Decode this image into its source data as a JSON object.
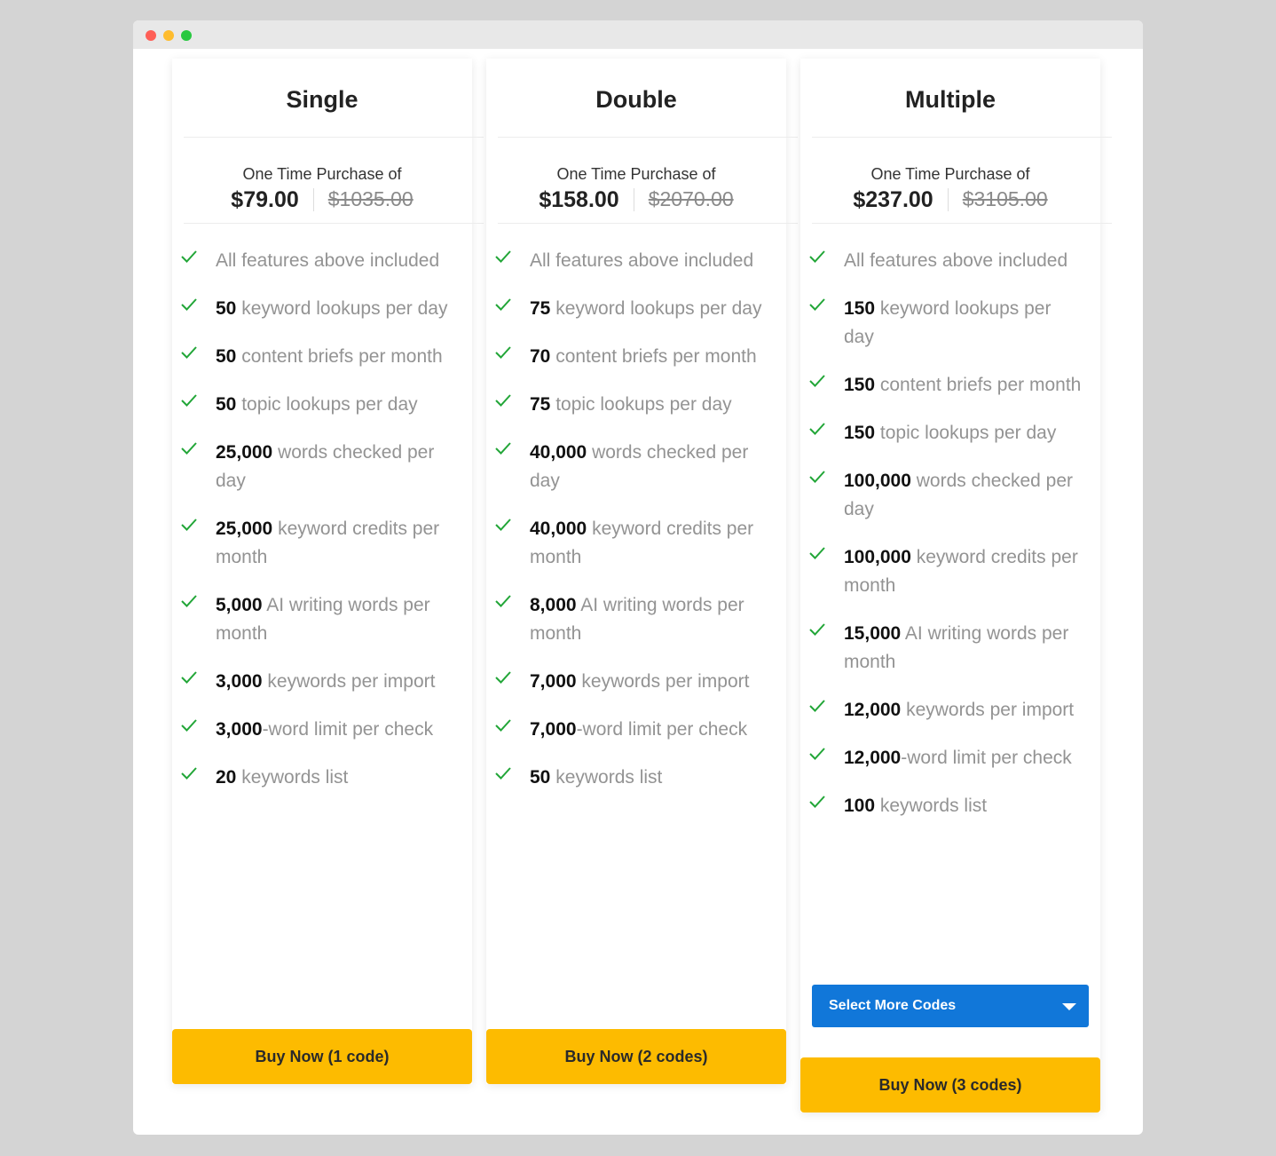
{
  "window": {
    "controls": [
      "close",
      "minimize",
      "maximize"
    ]
  },
  "colors": {
    "accent_buy": "#fdbb00",
    "accent_select": "#1177d9",
    "check": "#22a638"
  },
  "plans": [
    {
      "title": "Single",
      "purchase_label": "One Time Purchase of",
      "price": "$79.00",
      "old_price": "$1035.00",
      "features": [
        {
          "bold": "",
          "text": "All features above included"
        },
        {
          "bold": "50",
          "text": " keyword lookups per day"
        },
        {
          "bold": "50",
          "text": " content briefs per month"
        },
        {
          "bold": "50",
          "text": " topic lookups per day"
        },
        {
          "bold": "25,000",
          "text": " words checked per day"
        },
        {
          "bold": "25,000",
          "text": " keyword credits per month"
        },
        {
          "bold": "5,000",
          "text": " AI writing words per month"
        },
        {
          "bold": "3,000",
          "text": " keywords per import"
        },
        {
          "bold": "3,000",
          "text": "-word limit per check"
        },
        {
          "bold": "20",
          "text": " keywords list"
        }
      ],
      "buy_label": "Buy Now (1 code)"
    },
    {
      "title": "Double",
      "purchase_label": "One Time Purchase of",
      "price": "$158.00",
      "old_price": "$2070.00",
      "features": [
        {
          "bold": "",
          "text": "All features above included"
        },
        {
          "bold": "75",
          "text": " keyword lookups per day"
        },
        {
          "bold": "70",
          "text": " content briefs per month"
        },
        {
          "bold": "75",
          "text": " topic lookups per day"
        },
        {
          "bold": "40,000",
          "text": " words checked per day"
        },
        {
          "bold": "40,000",
          "text": " keyword credits per month"
        },
        {
          "bold": "8,000",
          "text": " AI writing words per month"
        },
        {
          "bold": "7,000",
          "text": " keywords per import"
        },
        {
          "bold": "7,000",
          "text": "-word limit per check"
        },
        {
          "bold": "50",
          "text": " keywords list"
        }
      ],
      "buy_label": "Buy Now (2 codes)"
    },
    {
      "title": "Multiple",
      "purchase_label": "One Time Purchase of",
      "price": "$237.00",
      "old_price": "$3105.00",
      "features": [
        {
          "bold": "",
          "text": "All features above included"
        },
        {
          "bold": "150",
          "text": " keyword lookups per day"
        },
        {
          "bold": "150",
          "text": " content briefs per month"
        },
        {
          "bold": "150",
          "text": " topic lookups per day"
        },
        {
          "bold": "100,000",
          "text": " words checked per day"
        },
        {
          "bold": "100,000",
          "text": " keyword credits per month"
        },
        {
          "bold": "15,000",
          "text": " AI writing words per month"
        },
        {
          "bold": "12,000",
          "text": " keywords per import"
        },
        {
          "bold": "12,000",
          "text": "-word limit per check"
        },
        {
          "bold": "100",
          "text": " keywords list"
        }
      ],
      "select_label": "Select More Codes",
      "buy_label": "Buy Now (3 codes)"
    }
  ]
}
